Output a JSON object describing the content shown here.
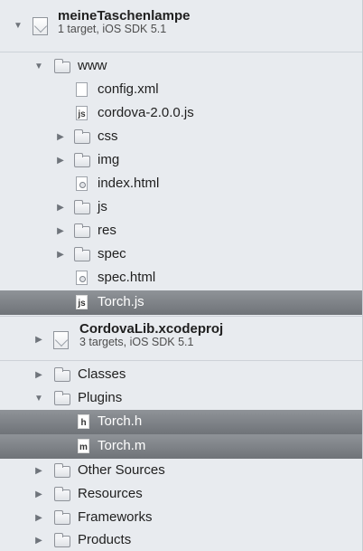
{
  "project_main": {
    "title": "meineTaschenlampe",
    "subtitle": "1 target, iOS SDK 5.1"
  },
  "www_tree": [
    {
      "label": "www",
      "kind": "folder",
      "expanded": true
    },
    {
      "label": "config.xml",
      "kind": "file"
    },
    {
      "label": "cordova-2.0.0.js",
      "kind": "js"
    },
    {
      "label": "css",
      "kind": "folder",
      "expanded": false
    },
    {
      "label": "img",
      "kind": "folder",
      "expanded": false
    },
    {
      "label": "index.html",
      "kind": "html"
    },
    {
      "label": "js",
      "kind": "folder",
      "expanded": false
    },
    {
      "label": "res",
      "kind": "folder",
      "expanded": false
    },
    {
      "label": "spec",
      "kind": "folder",
      "expanded": false
    },
    {
      "label": "spec.html",
      "kind": "html"
    },
    {
      "label": "Torch.js",
      "kind": "js",
      "selected": true
    }
  ],
  "project_lib": {
    "title": "CordovaLib.xcodeproj",
    "subtitle": "3 targets, iOS SDK 5.1"
  },
  "groups": [
    {
      "label": "Classes",
      "expanded": false
    },
    {
      "label": "Plugins",
      "expanded": true
    },
    {
      "label": "Torch.h",
      "kind": "h",
      "selected": true
    },
    {
      "label": "Torch.m",
      "kind": "m",
      "selected": true
    },
    {
      "label": "Other Sources",
      "expanded": false
    },
    {
      "label": "Resources",
      "expanded": false
    },
    {
      "label": "Frameworks",
      "expanded": false
    },
    {
      "label": "Products",
      "expanded": false
    }
  ],
  "icon_glyphs": {
    "disclosure_open": "▼",
    "disclosure_closed": "▶",
    "js_badge": "js",
    "h_badge": "h",
    "m_badge": "m"
  },
  "colors": {
    "sidebar_bg": "#e8ebef",
    "selection": "#7f8388"
  }
}
